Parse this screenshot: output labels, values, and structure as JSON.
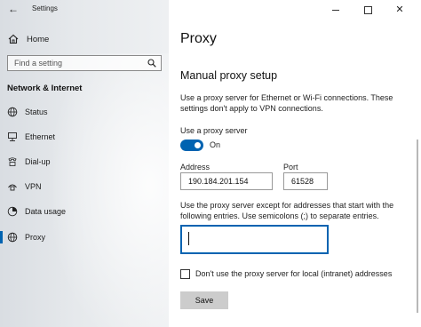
{
  "window": {
    "app_title": "Settings",
    "back_glyph": "←",
    "close_glyph": "✕"
  },
  "sidebar": {
    "home_label": "Home",
    "search_placeholder": "Find a setting",
    "section_title": "Network & Internet",
    "items": [
      {
        "label": "Status",
        "icon": "globe-network-icon"
      },
      {
        "label": "Ethernet",
        "icon": "ethernet-icon"
      },
      {
        "label": "Dial-up",
        "icon": "dialup-icon"
      },
      {
        "label": "VPN",
        "icon": "vpn-icon"
      },
      {
        "label": "Data usage",
        "icon": "data-usage-icon"
      },
      {
        "label": "Proxy",
        "icon": "globe-icon",
        "selected": true
      }
    ]
  },
  "main": {
    "page_title": "Proxy",
    "subhead": "Manual proxy setup",
    "description": "Use a proxy server for Ethernet or Wi-Fi connections. These settings don't apply to VPN connections.",
    "toggle": {
      "label": "Use a proxy server",
      "state": "On",
      "on": true
    },
    "address": {
      "label": "Address",
      "value": "190.184.201.154"
    },
    "port": {
      "label": "Port",
      "value": "61528"
    },
    "exceptions": {
      "description": "Use the proxy server except for addresses that start with the following entries. Use semicolons (;) to separate entries.",
      "value": ""
    },
    "local_checkbox": {
      "label": "Don't use the proxy server for local (intranet) addresses",
      "checked": false
    },
    "save_label": "Save"
  },
  "colors": {
    "accent": "#0063b1",
    "button_gray": "#cccccc"
  }
}
